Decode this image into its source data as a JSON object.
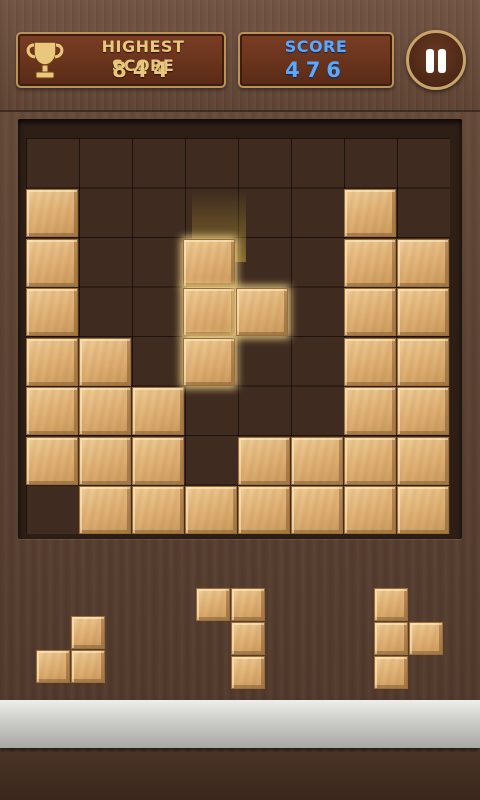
{
  "header": {
    "highest_score_label": "HIGHEST SCORE",
    "highest_score_value": "844",
    "score_label": "SCORE",
    "score_value": "476",
    "pause_icon": "pause-icon",
    "trophy_icon": "trophy-icon"
  },
  "board": {
    "columns": 8,
    "rows": 8,
    "placed_cells": [
      [
        0,
        2
      ],
      [
        0,
        3
      ],
      [
        0,
        4
      ],
      [
        0,
        5
      ],
      [
        0,
        6
      ],
      [
        0,
        7
      ],
      [
        1,
        5
      ],
      [
        1,
        6
      ],
      [
        1,
        7
      ],
      [
        1,
        8
      ],
      [
        2,
        6
      ],
      [
        2,
        7
      ],
      [
        2,
        8
      ],
      [
        3,
        8
      ],
      [
        4,
        8
      ],
      [
        4,
        7
      ],
      [
        5,
        7
      ],
      [
        5,
        8
      ],
      [
        6,
        2
      ],
      [
        6,
        3
      ],
      [
        6,
        4
      ],
      [
        6,
        5
      ],
      [
        6,
        6
      ],
      [
        6,
        7
      ],
      [
        6,
        8
      ],
      [
        7,
        3
      ],
      [
        7,
        4
      ],
      [
        7,
        5
      ],
      [
        7,
        6
      ],
      [
        7,
        7
      ],
      [
        7,
        8
      ]
    ],
    "preview_cells": [
      [
        3,
        3
      ],
      [
        3,
        4
      ],
      [
        3,
        5
      ],
      [
        4,
        4
      ]
    ]
  },
  "tray": {
    "pieces": [
      {
        "name": "piece-l-small",
        "cells": [
          [
            1,
            0
          ],
          [
            0,
            1
          ],
          [
            1,
            1
          ]
        ]
      },
      {
        "name": "piece-j-tall",
        "cells": [
          [
            0,
            0
          ],
          [
            1,
            0
          ],
          [
            1,
            1
          ],
          [
            1,
            2
          ]
        ]
      },
      {
        "name": "piece-t-vertical",
        "cells": [
          [
            0,
            0
          ],
          [
            0,
            1
          ],
          [
            1,
            1
          ],
          [
            0,
            2
          ]
        ]
      }
    ]
  },
  "colors": {
    "wood_block": "#e0b074",
    "board_bg": "#3f2b1f",
    "score_blue": "#5aa8ff",
    "highscore_gold": "#e9c77c"
  }
}
